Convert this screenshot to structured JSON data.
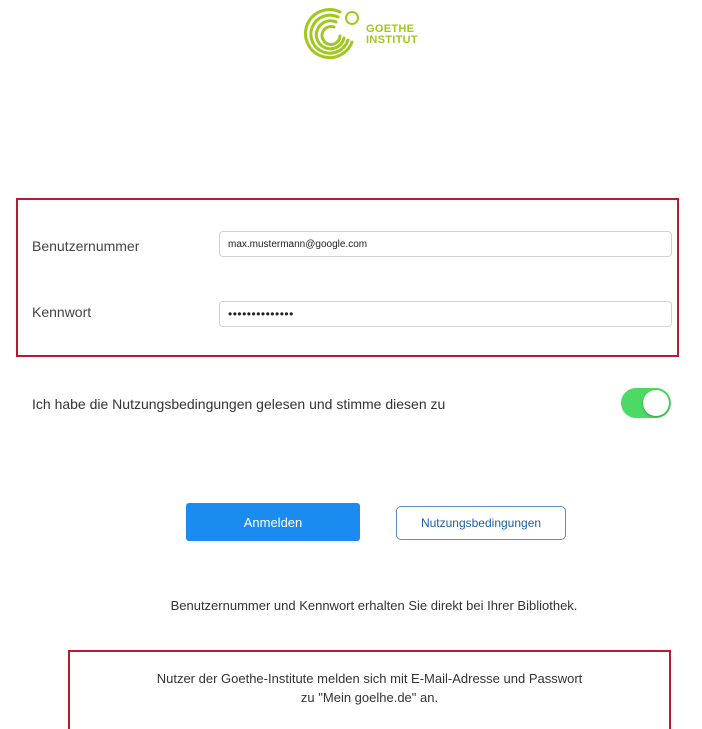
{
  "brand": {
    "line1": "GOETHE",
    "line2": "INSTITUT",
    "color": "#a0c81e"
  },
  "login": {
    "username_label": "Benutzernummer",
    "username_value": "max.mustermann@google.com",
    "password_label": "Kennwort",
    "password_value": "••••••••••••••"
  },
  "terms": {
    "text": "Ich habe die Nutzungsbedingungen gelesen und stimme diesen zu",
    "toggle_on": true
  },
  "buttons": {
    "login": "Anmelden",
    "terms": "Nutzungsbedingungen"
  },
  "info": "Benutzernummer und Kennwort erhalten Sie direkt bei Ihrer Bibliothek.",
  "note": {
    "line1": "Nutzer der Goethe-Institute melden sich mit E-Mail-Adresse und Passwort",
    "line2": "zu \"Mein goelhe.de\" an."
  },
  "colors": {
    "accent_blue": "#1a8cf0",
    "toggle_green": "#4cd964",
    "highlight_red": "#b51d2e"
  }
}
